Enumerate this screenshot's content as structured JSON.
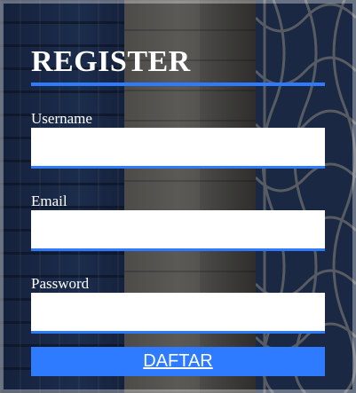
{
  "form": {
    "title": "REGISTER",
    "fields": [
      {
        "label": "Username",
        "value": "",
        "placeholder": ""
      },
      {
        "label": "Email",
        "value": "",
        "placeholder": ""
      },
      {
        "label": "Password",
        "value": "",
        "placeholder": ""
      }
    ],
    "submit_label": "DAFTAR"
  },
  "colors": {
    "accent": "#2f7bff",
    "text": "#ffffff",
    "input_background": "#ffffff"
  }
}
